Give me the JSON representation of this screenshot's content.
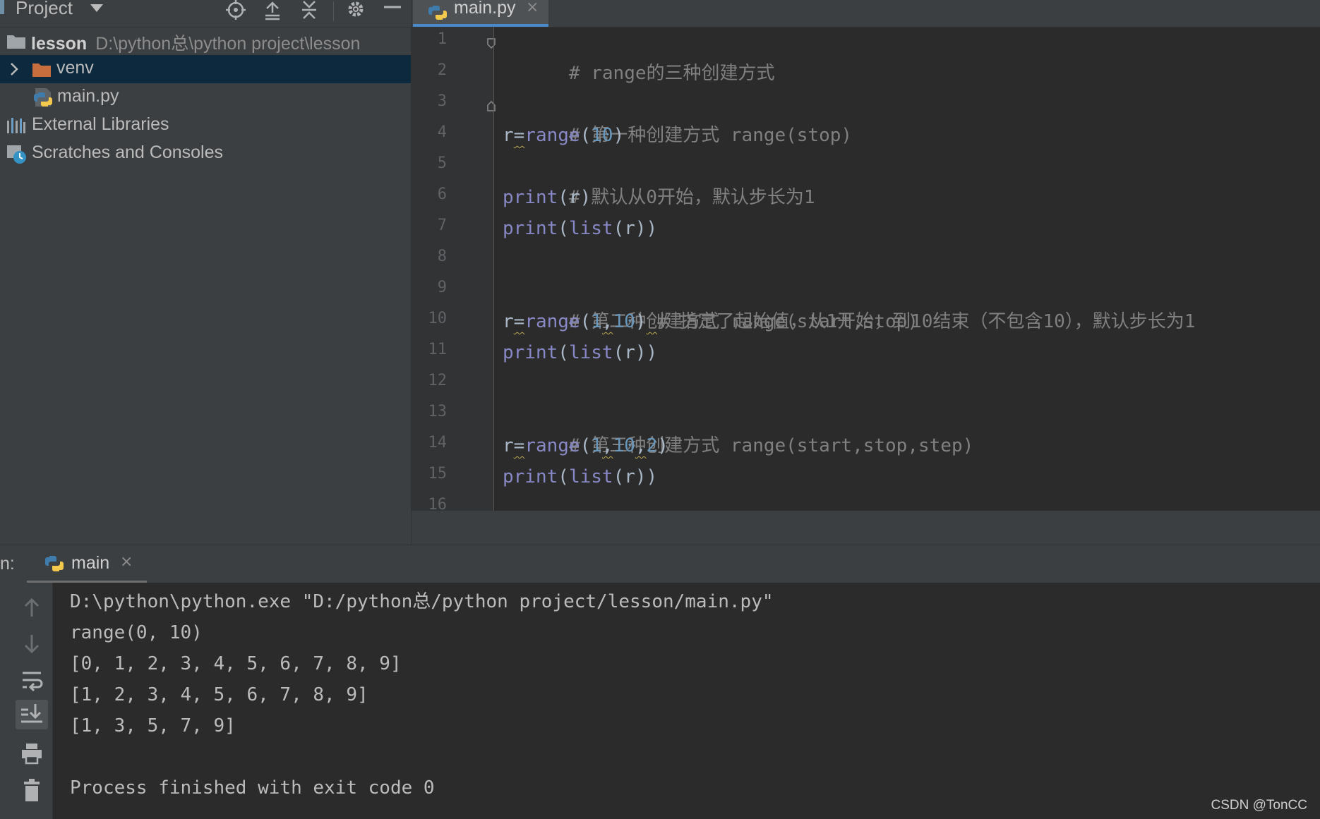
{
  "project_panel": {
    "title": "Project",
    "tree": [
      {
        "label": "lesson",
        "path": "D:\\python总\\python project\\lesson"
      },
      {
        "label": "venv"
      },
      {
        "label": "main.py"
      },
      {
        "label": "External Libraries"
      },
      {
        "label": "Scratches and Consoles"
      }
    ]
  },
  "editor": {
    "tab_label": "main.py",
    "close_glyph": "×",
    "line_numbers": [
      "1",
      "2",
      "3",
      "4",
      "5",
      "6",
      "7",
      "8",
      "9",
      "10",
      "11",
      "12",
      "13",
      "14",
      "15",
      "16"
    ],
    "code": {
      "l1": "# range的三种创建方式",
      "l3": "# 第一种创建方式 range(stop)",
      "l4": {
        "a": "r",
        "b": "=",
        "c": "range",
        "d": "(",
        "e": "10",
        "f": ")"
      },
      "l5": "# 默认从0开始，默认步长为1",
      "l6": {
        "a": "print",
        "b": "(r)"
      },
      "l7": {
        "a": "print",
        "b": "(",
        "c": "list",
        "d": "(r))"
      },
      "l9": "# 第二种创建方式 range(start,stop)",
      "l10": {
        "a": "r",
        "b": "=",
        "c": "range",
        "d": "(",
        "e": "1",
        "f": ",",
        "g": "10",
        "h": ")",
        "i": " ",
        "j": "# 指定了起始值，从1开始，到10结束（不包含10），默认步长为1"
      },
      "l11": {
        "a": "print",
        "b": "(",
        "c": "list",
        "d": "(r))"
      },
      "l13": "# 第三种创建方式 range(start,stop,step)",
      "l14": {
        "a": "r",
        "b": "=",
        "c": "range",
        "d": "(",
        "e": "1",
        "f": ",",
        "g": "10",
        "h": ",",
        "i": "2",
        "j": ")"
      },
      "l15": {
        "a": "print",
        "b": "(",
        "c": "list",
        "d": "(r))"
      }
    }
  },
  "run_panel": {
    "label": "n:",
    "tab_label": "main",
    "close_glyph": "×",
    "console": [
      "D:\\python\\python.exe \"D:/python总/python project/lesson/main.py\"",
      "range(0, 10)",
      "[0, 1, 2, 3, 4, 5, 6, 7, 8, 9]",
      "[1, 2, 3, 4, 5, 6, 7, 8, 9]",
      "[1, 3, 5, 7, 9]",
      "",
      "Process finished with exit code 0"
    ]
  },
  "watermark": "CSDN @TonCC",
  "colors": {
    "panel_bg": "#3c3f41",
    "editor_bg": "#2b2b2b",
    "selection": "#0d293e",
    "keyword_builtin": "#8888c6",
    "number": "#6897bb",
    "comment": "#808080",
    "tab_underline": "#4a88c7"
  }
}
